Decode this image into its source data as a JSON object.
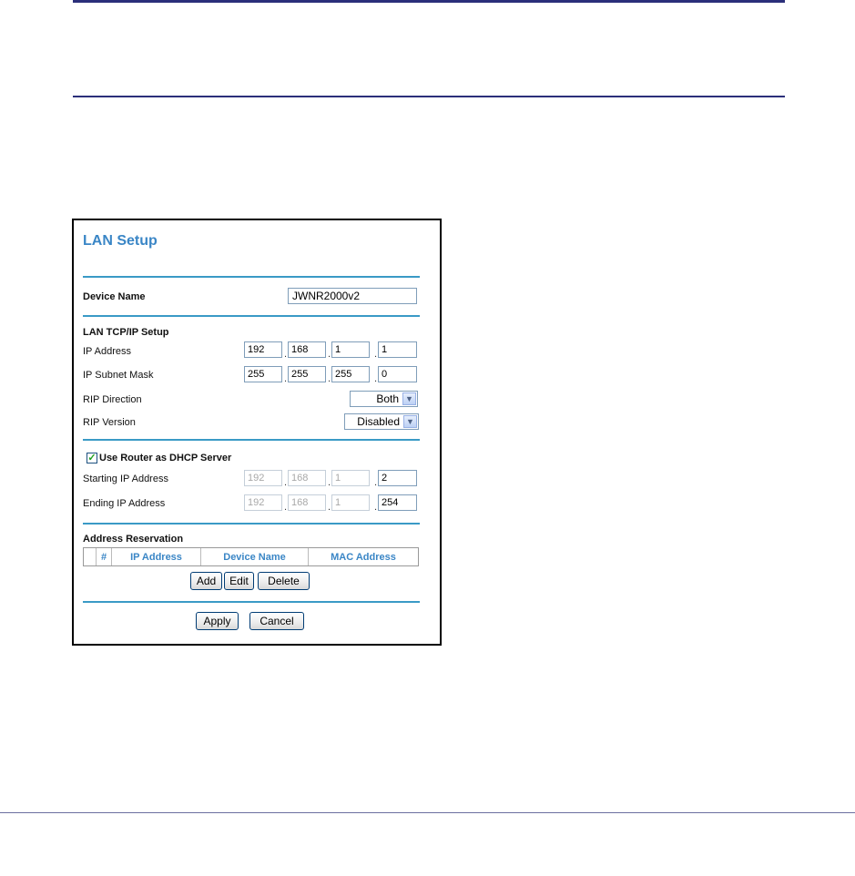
{
  "panel": {
    "title": "LAN Setup",
    "device_name_label": "Device Name",
    "device_name_value": "JWNR2000v2",
    "tcpip_heading": "LAN TCP/IP Setup",
    "ip_address_label": "IP Address",
    "ip_address": [
      "192",
      "168",
      "1",
      "1"
    ],
    "subnet_label": "IP Subnet Mask",
    "subnet": [
      "255",
      "255",
      "255",
      "0"
    ],
    "rip_direction_label": "RIP Direction",
    "rip_direction_value": "Both",
    "rip_version_label": "RIP Version",
    "rip_version_value": "Disabled",
    "dhcp_checkbox_label": "Use Router as DHCP Server",
    "dhcp_checked": true,
    "start_ip_label": "Starting IP Address",
    "start_ip": [
      "192",
      "168",
      "1",
      "2"
    ],
    "end_ip_label": "Ending IP Address",
    "end_ip": [
      "192",
      "168",
      "1",
      "254"
    ],
    "reservation_heading": "Address Reservation",
    "table_headers": [
      "",
      "#",
      "IP Address",
      "Device Name",
      "MAC Address"
    ],
    "add_label": "Add",
    "edit_label": "Edit",
    "delete_label": "Delete",
    "apply_label": "Apply",
    "cancel_label": "Cancel"
  },
  "icons": {
    "dropdown": "chevron-down-icon",
    "checkbox": "checkmark-icon"
  },
  "colors": {
    "title": "#3a86c6",
    "divider": "#3a9ac6",
    "doc_rule": "#2b2f7a"
  }
}
